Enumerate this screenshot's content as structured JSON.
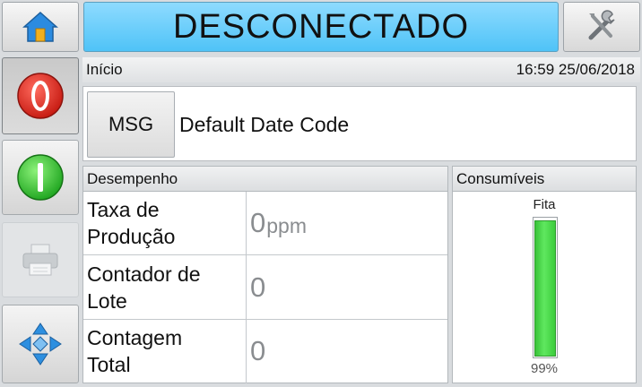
{
  "header": {
    "status": "DESCONECTADO",
    "home_icon": "home-icon",
    "tools_icon": "tools-icon"
  },
  "sidebar": {
    "items": [
      {
        "name": "stop",
        "icon": "stop-icon",
        "color": "#e8332b"
      },
      {
        "name": "start",
        "icon": "start-icon",
        "color": "#37c437"
      },
      {
        "name": "print",
        "icon": "printer-icon"
      },
      {
        "name": "navigate",
        "icon": "directional-arrows-icon",
        "color": "#2d8fe0"
      }
    ]
  },
  "breadcrumb": {
    "location": "Início",
    "datetime": "16:59 25/06/2018"
  },
  "message": {
    "label": "MSG",
    "text": "Default Date Code"
  },
  "performance": {
    "title": "Desempenho",
    "rows": [
      {
        "label_line1": "Taxa de",
        "label_line2": "Produção",
        "value": "0",
        "unit": "ppm"
      },
      {
        "label_line1": "Contador de",
        "label_line2": "Lote",
        "value": "0",
        "unit": ""
      },
      {
        "label_line1": "Contagem",
        "label_line2": "Total",
        "value": "0",
        "unit": ""
      }
    ]
  },
  "consumables": {
    "title": "Consumíveis",
    "tape_label": "Fita",
    "tape_level_text": "99%",
    "tape_level": 0.99,
    "tape_color": "#3ccc3c"
  }
}
